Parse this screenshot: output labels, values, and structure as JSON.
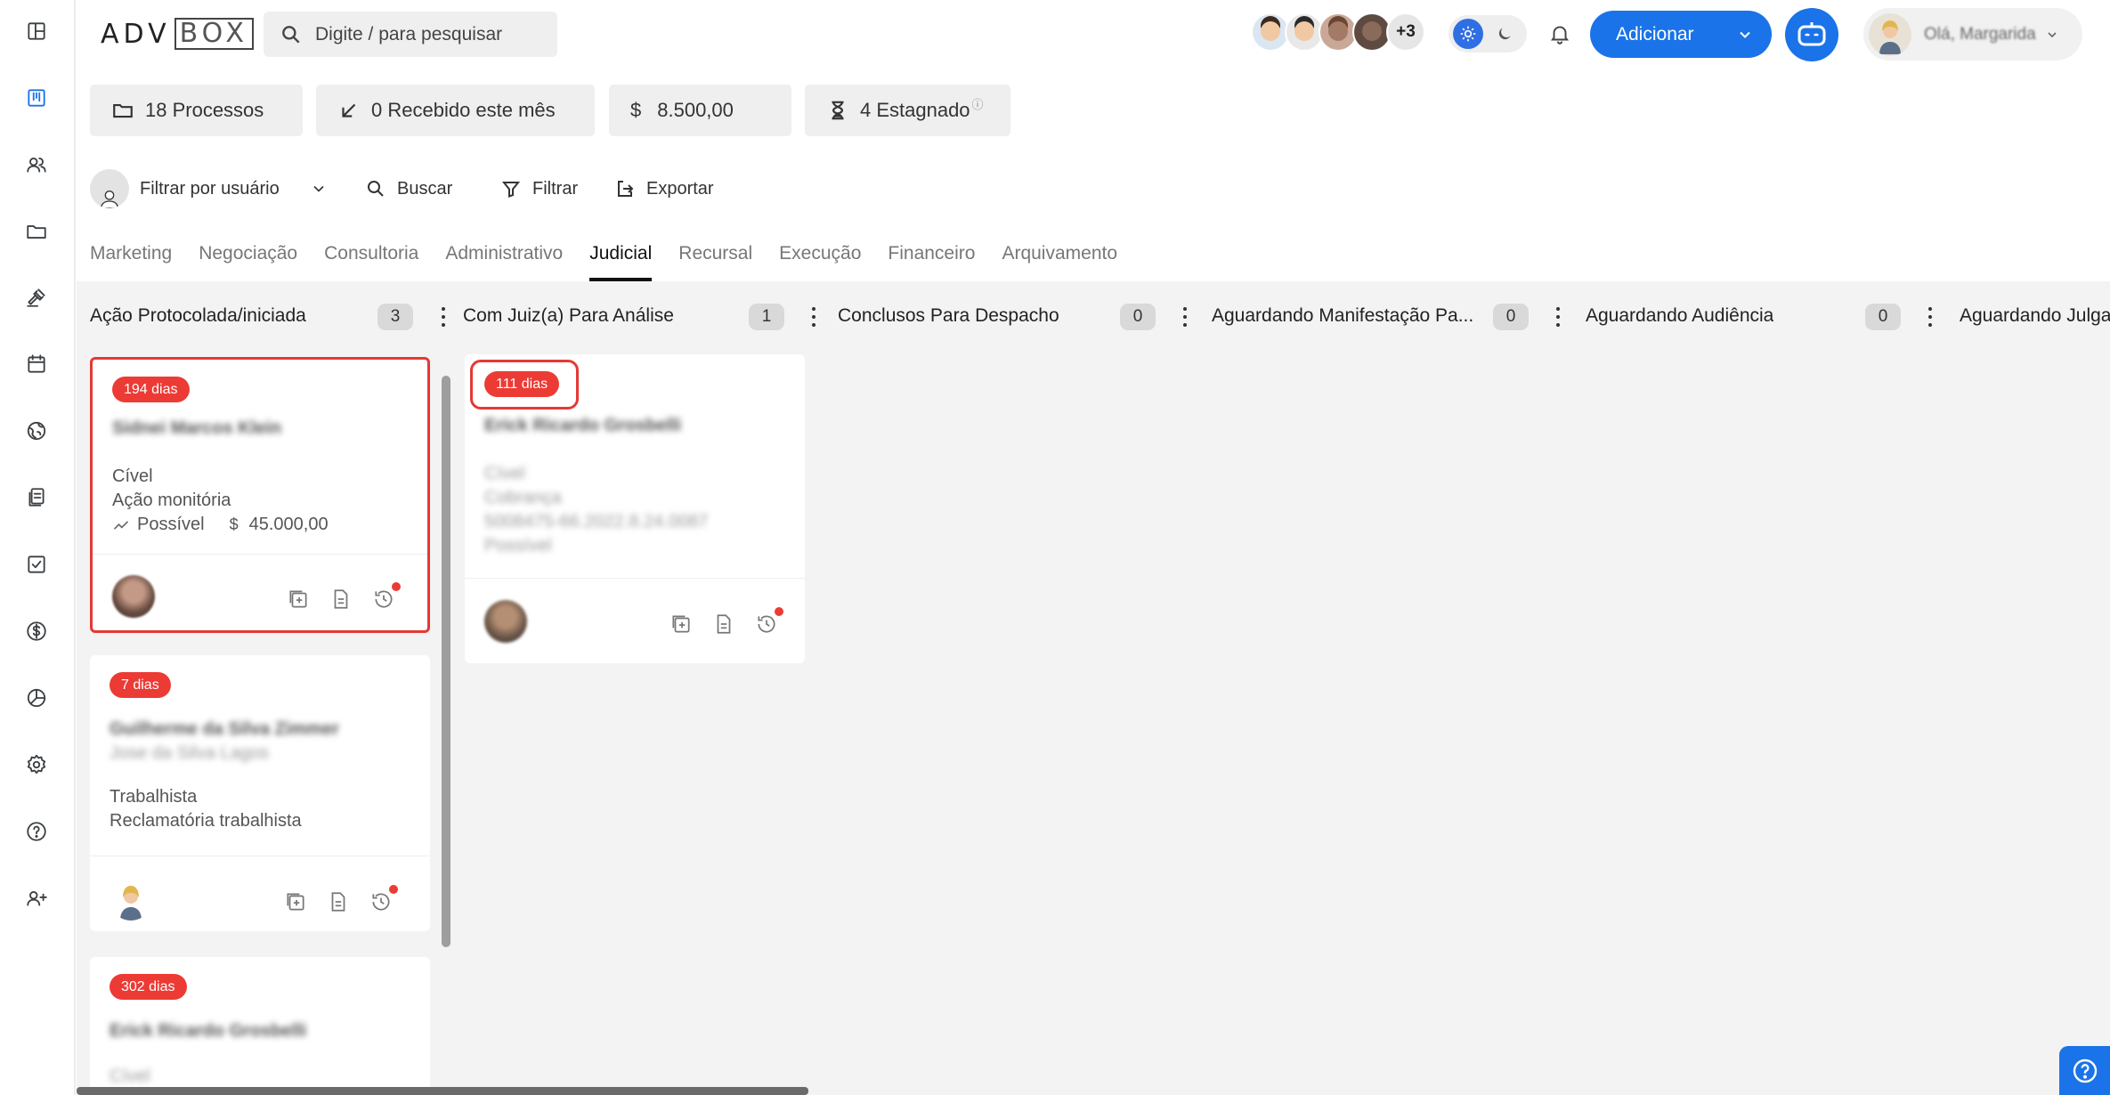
{
  "app": {
    "logo_left": "ADV",
    "logo_box": "BOX"
  },
  "sidebar": {
    "items": [
      {
        "icon": "dashboard-icon"
      },
      {
        "icon": "kanban-icon",
        "active": true
      },
      {
        "icon": "users-icon"
      },
      {
        "icon": "folder-icon"
      },
      {
        "icon": "gavel-icon"
      },
      {
        "icon": "calendar-icon"
      },
      {
        "icon": "globe-icon"
      },
      {
        "icon": "documents-icon"
      },
      {
        "icon": "checkbox-icon"
      },
      {
        "icon": "dollar-icon"
      },
      {
        "icon": "pie-chart-icon"
      },
      {
        "icon": "settings-icon"
      },
      {
        "icon": "help-icon"
      },
      {
        "icon": "add-user-icon"
      }
    ]
  },
  "header": {
    "search_placeholder": "Digite / para pesquisar",
    "team_more": "+3",
    "add_button": "Adicionar",
    "greeting": "Olá, Margarida"
  },
  "stats": {
    "processes": "18 Processos",
    "received": "0 Recebido este mês",
    "currency_symbol": "$",
    "amount": "8.500,00",
    "stagnant": "4 Estagnado"
  },
  "toolbar": {
    "filter_user": "Filtrar por usuário",
    "search": "Buscar",
    "filter": "Filtrar",
    "export": "Exportar"
  },
  "tabs": [
    "Marketing",
    "Negociação",
    "Consultoria",
    "Administrativo",
    "Judicial",
    "Recursal",
    "Execução",
    "Financeiro",
    "Arquivamento"
  ],
  "active_tab": "Judicial",
  "columns": [
    {
      "title": "Ação Protocolada/iniciada",
      "count": "3"
    },
    {
      "title": "Com Juiz(a) Para Análise",
      "count": "1"
    },
    {
      "title": "Conclusos Para Despacho",
      "count": "0"
    },
    {
      "title": "Aguardando Manifestação Pa...",
      "count": "0"
    },
    {
      "title": "Aguardando Audiência",
      "count": "0"
    },
    {
      "title": "Aguardando Julga"
    }
  ],
  "cards": {
    "c1": {
      "days": "194 dias",
      "name": "Sidnei Marcos Klein",
      "area": "Cível",
      "action": "Ação monitória",
      "chance": "Possível",
      "currency": "$",
      "value": "45.000,00"
    },
    "c2": {
      "days": "7 dias",
      "name": "Guilherme da Silva Zimmer",
      "party": "Jose da Silva Lagos",
      "area": "Trabalhista",
      "action": "Reclamatória trabalhista"
    },
    "c3": {
      "days": "302 dias",
      "name": "Erick Ricardo Grosbelli",
      "area": "Cível"
    },
    "c4": {
      "days": "111 dias",
      "name": "Erick Ricardo Grosbelli",
      "area": "Cível",
      "action": "Cobrança",
      "number": "5008475-66.2022.8.24.0087",
      "chance": "Possível"
    }
  },
  "colors": {
    "accent": "#1a73e8",
    "badge": "#ec3b34",
    "highlight": "#e53935"
  }
}
